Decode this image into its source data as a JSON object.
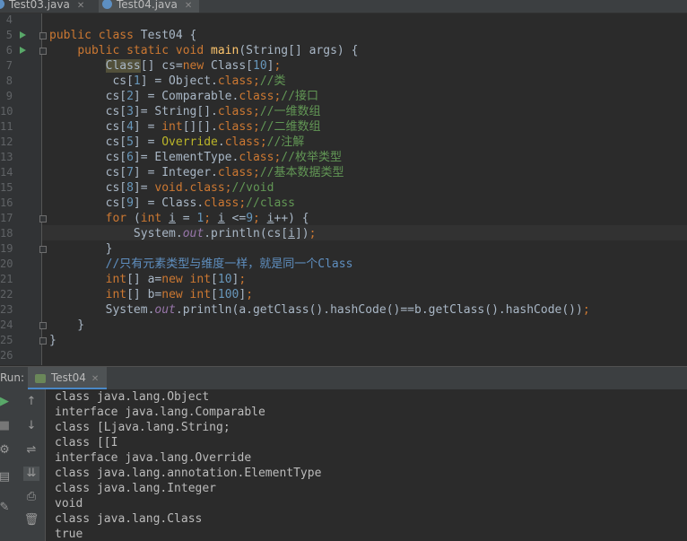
{
  "tabs": [
    {
      "label": "Test03.java",
      "active": false
    },
    {
      "label": "Test04.java",
      "active": true
    }
  ],
  "editor": {
    "line_numbers": [
      "4",
      "5",
      "6",
      "7",
      "8",
      "9",
      "10",
      "11",
      "12",
      "13",
      "14",
      "15",
      "16",
      "17",
      "18",
      "19",
      "20",
      "21",
      "22",
      "23",
      "24",
      "25",
      "26"
    ]
  },
  "run": {
    "label": "Run:",
    "tab_label": "Test04"
  },
  "console": {
    "lines": [
      "class java.lang.Object",
      "interface java.lang.Comparable",
      "class [Ljava.lang.String;",
      "class [[I",
      "interface java.lang.Override",
      "class java.lang.annotation.ElementType",
      "class java.lang.Integer",
      "void",
      "class java.lang.Class",
      "true"
    ]
  },
  "icons": [
    "java-file-icon",
    "run-icon",
    "stop-icon",
    "rerun-icon",
    "up-arrow-icon",
    "down-arrow-icon",
    "soft-wrap-icon",
    "scroll-to-end-icon",
    "print-icon",
    "trash-icon",
    "pin-icon",
    "settings-icon",
    "layout-icon"
  ],
  "colors": {
    "keyword": "#cc7832",
    "method": "#ffc66d",
    "number": "#6897bb",
    "comment": "#629755",
    "static": "#9876aa",
    "annotation": "#bbb529",
    "text": "#a9b7c6"
  }
}
